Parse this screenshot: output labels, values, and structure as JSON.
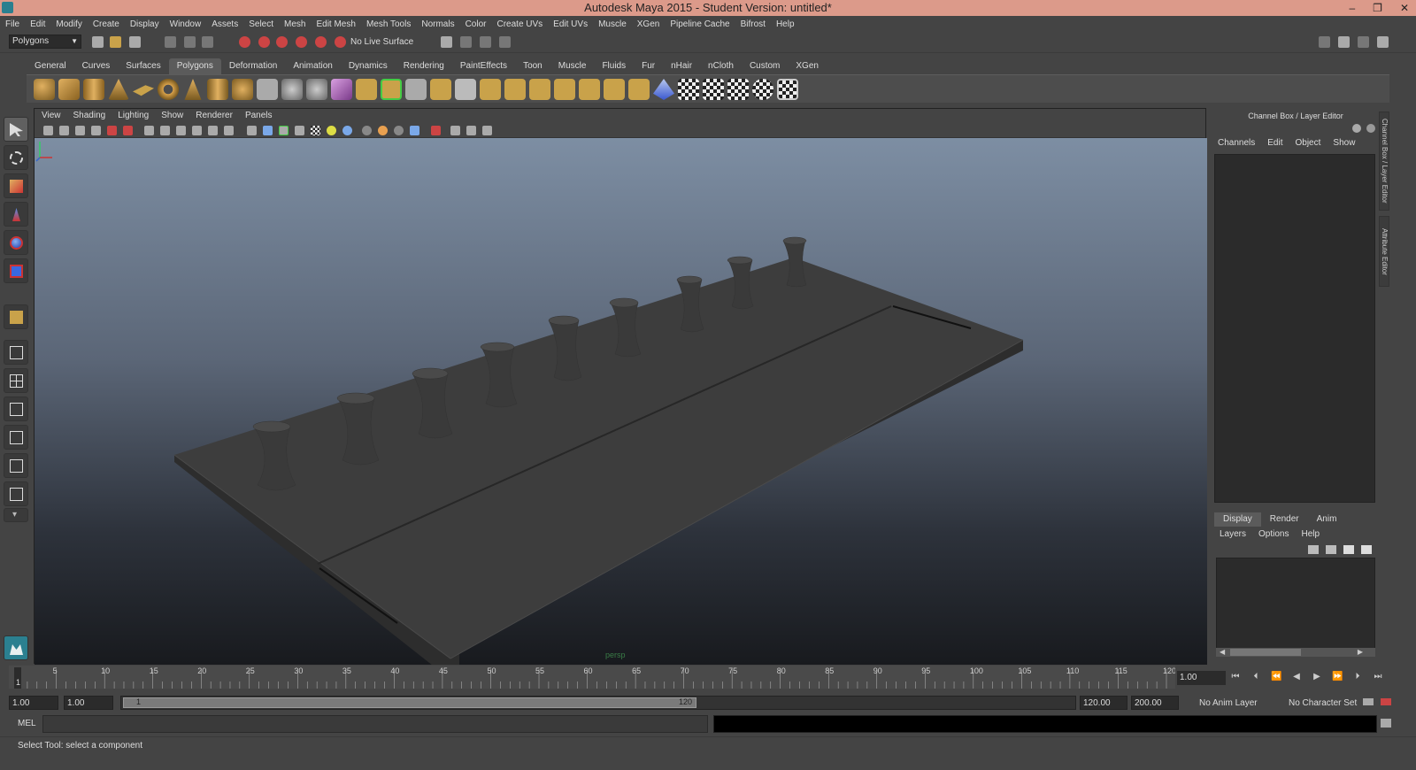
{
  "window": {
    "title": "Autodesk Maya 2015 - Student Version: untitled*"
  },
  "menu": [
    "File",
    "Edit",
    "Modify",
    "Create",
    "Display",
    "Window",
    "Assets",
    "Select",
    "Mesh",
    "Edit Mesh",
    "Mesh Tools",
    "Normals",
    "Color",
    "Create UVs",
    "Edit UVs",
    "Muscle",
    "XGen",
    "Pipeline Cache",
    "Bifrost",
    "Help"
  ],
  "statusline": {
    "mode": "Polygons",
    "live_surface": "No Live Surface"
  },
  "shelf": {
    "tabs": [
      "General",
      "Curves",
      "Surfaces",
      "Polygons",
      "Deformation",
      "Animation",
      "Dynamics",
      "Rendering",
      "PaintEffects",
      "Toon",
      "Muscle",
      "Fluids",
      "Fur",
      "nHair",
      "nCloth",
      "Custom",
      "XGen"
    ],
    "active_tab": "Polygons"
  },
  "viewport": {
    "menu": [
      "View",
      "Shading",
      "Lighting",
      "Show",
      "Renderer",
      "Panels"
    ],
    "camera": "persp"
  },
  "channel_box": {
    "title": "Channel Box / Layer Editor",
    "menu": [
      "Channels",
      "Edit",
      "Object",
      "Show"
    ],
    "side_tabs": [
      "Channel Box / Layer Editor",
      "Attribute Editor"
    ]
  },
  "layer_editor": {
    "tabs": [
      "Display",
      "Render",
      "Anim"
    ],
    "active_tab": "Display",
    "menu": [
      "Layers",
      "Options",
      "Help"
    ]
  },
  "timeline": {
    "ticks": [
      1,
      5,
      10,
      15,
      20,
      25,
      30,
      35,
      40,
      45,
      50,
      55,
      60,
      65,
      70,
      75,
      80,
      85,
      90,
      95,
      100,
      105,
      110,
      115,
      120
    ],
    "current_frame": "1.00"
  },
  "range": {
    "start": "1.00",
    "playback_start": "1.00",
    "slider_start": "1",
    "slider_end": "120",
    "playback_end": "120.00",
    "end": "200.00",
    "anim_layer": "No Anim Layer",
    "character_set": "No Character Set"
  },
  "command": {
    "label": "MEL"
  },
  "help": {
    "text": "Select Tool: select a component"
  },
  "colors": {
    "title_bar": "#dc9a8a",
    "ui_bg": "#444444",
    "active_tab": "#5b5b5b"
  }
}
